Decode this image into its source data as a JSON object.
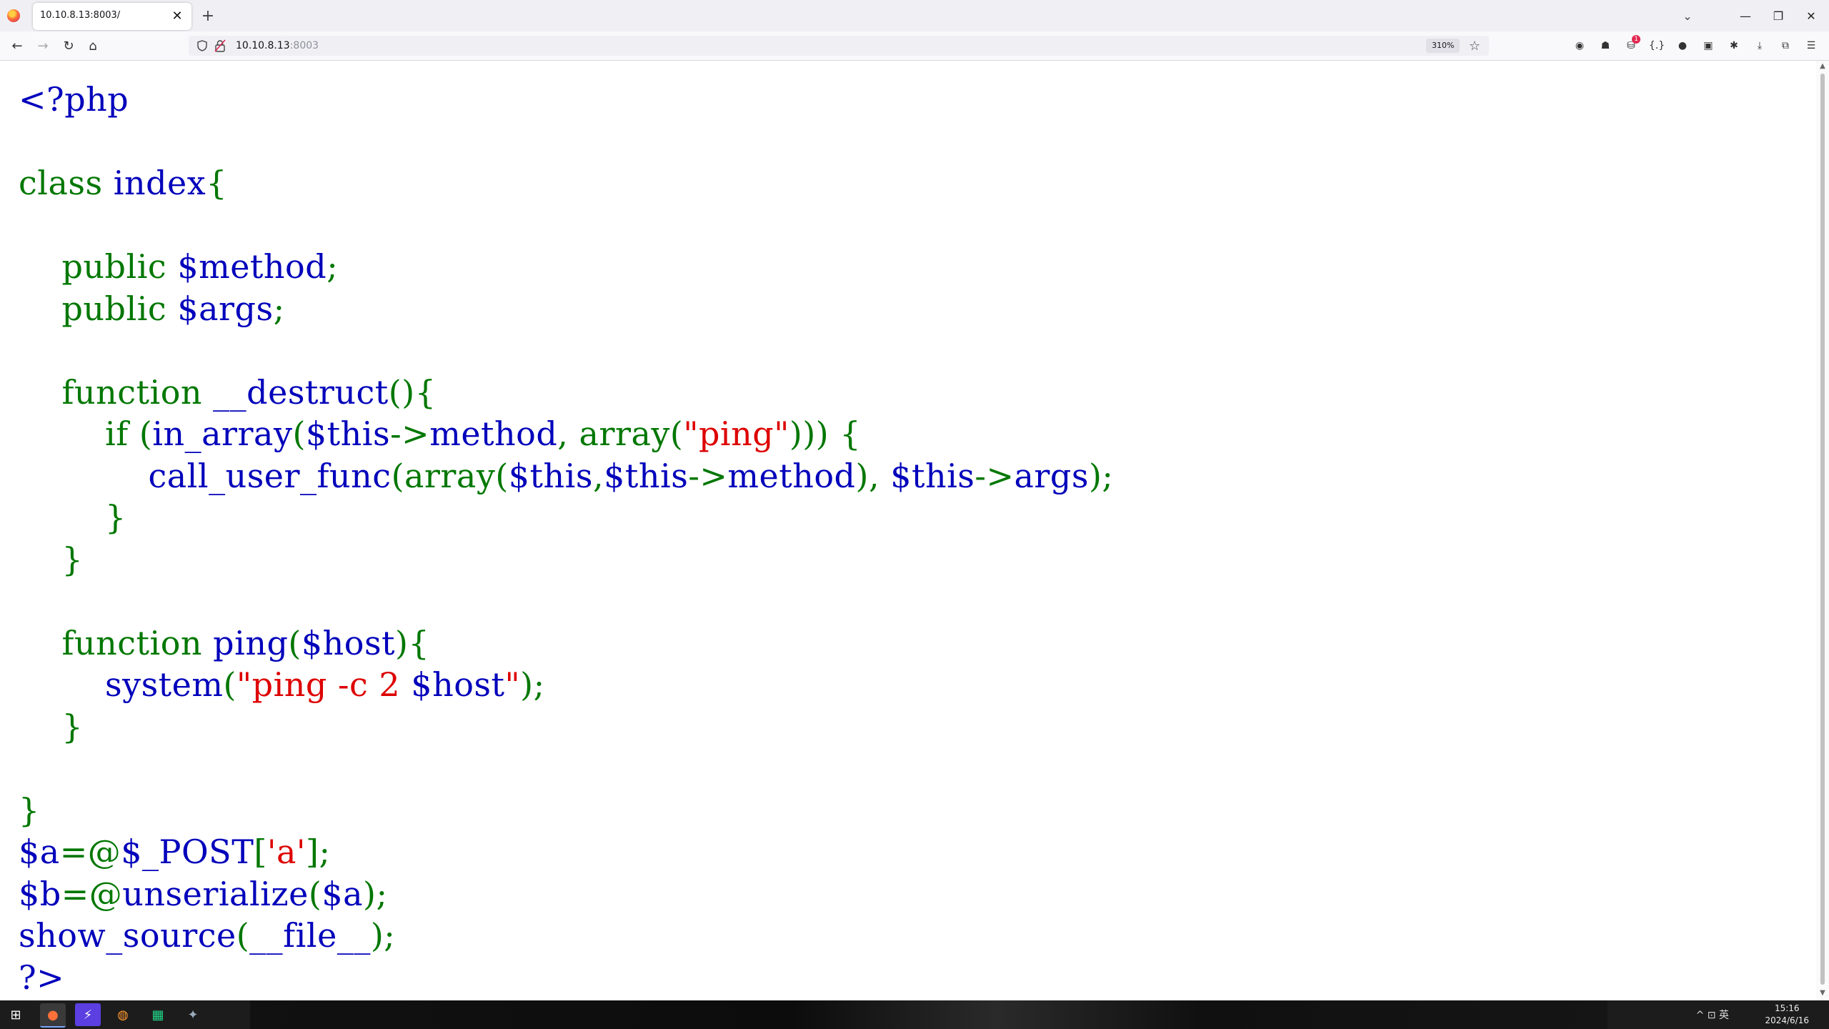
{
  "browser": {
    "tab_title": "10.10.8.13:8003/",
    "tab_close": "✕",
    "new_tab": "+",
    "tab_list": "⌄",
    "window_controls": {
      "minimize": "—",
      "restore": "❐",
      "close": "✕"
    },
    "nav": {
      "back": "←",
      "forward": "→",
      "reload": "↻",
      "home": "⌂"
    },
    "url_host": "10.10.8.13",
    "url_port": ":8003",
    "zoom_label": "310%",
    "bookmark_star": "☆",
    "extensions": [
      {
        "name": "circle-extension-icon",
        "glyph": "◉"
      },
      {
        "name": "hat-extension-icon",
        "glyph": "☗"
      },
      {
        "name": "badge-extension-icon",
        "glyph": "⛁",
        "badge": "1"
      },
      {
        "name": "braces-extension-icon",
        "glyph": "{.}"
      },
      {
        "name": "cookie-extension-icon",
        "glyph": "●"
      },
      {
        "name": "container-extension-icon",
        "glyph": "▣"
      },
      {
        "name": "gear-extension-icon",
        "glyph": "✱"
      },
      {
        "name": "downloads-icon",
        "glyph": "⤓"
      },
      {
        "name": "extensions-puzzle-icon",
        "glyph": "⧉"
      },
      {
        "name": "menu-icon",
        "glyph": "☰"
      }
    ]
  },
  "page": {
    "code_lines": [
      [
        {
          "t": "<?php",
          "c": "def"
        }
      ],
      [],
      [
        {
          "t": "class ",
          "c": "kw"
        },
        {
          "t": "index",
          "c": "def"
        },
        {
          "t": "{",
          "c": "kw"
        }
      ],
      [],
      [
        {
          "t": "    public ",
          "c": "kw"
        },
        {
          "t": "$method",
          "c": "def"
        },
        {
          "t": ";",
          "c": "kw"
        }
      ],
      [
        {
          "t": "    public ",
          "c": "kw"
        },
        {
          "t": "$args",
          "c": "def"
        },
        {
          "t": ";",
          "c": "kw"
        }
      ],
      [],
      [
        {
          "t": "    function ",
          "c": "kw"
        },
        {
          "t": "__destruct",
          "c": "def"
        },
        {
          "t": "(){",
          "c": "kw"
        }
      ],
      [
        {
          "t": "        if ",
          "c": "kw"
        },
        {
          "t": "(",
          "c": "kw"
        },
        {
          "t": "in_array",
          "c": "def"
        },
        {
          "t": "(",
          "c": "kw"
        },
        {
          "t": "$this",
          "c": "def"
        },
        {
          "t": "->",
          "c": "kw"
        },
        {
          "t": "method",
          "c": "def"
        },
        {
          "t": ", ",
          "c": "kw"
        },
        {
          "t": "array",
          "c": "kw"
        },
        {
          "t": "(",
          "c": "kw"
        },
        {
          "t": "\"ping\"",
          "c": "str"
        },
        {
          "t": "))) {",
          "c": "kw"
        }
      ],
      [
        {
          "t": "            call_user_func",
          "c": "def"
        },
        {
          "t": "(array(",
          "c": "kw"
        },
        {
          "t": "$this",
          "c": "def"
        },
        {
          "t": ",",
          "c": "kw"
        },
        {
          "t": "$this",
          "c": "def"
        },
        {
          "t": "->",
          "c": "kw"
        },
        {
          "t": "method",
          "c": "def"
        },
        {
          "t": "), ",
          "c": "kw"
        },
        {
          "t": "$this",
          "c": "def"
        },
        {
          "t": "->",
          "c": "kw"
        },
        {
          "t": "args",
          "c": "def"
        },
        {
          "t": ");",
          "c": "kw"
        }
      ],
      [
        {
          "t": "        }",
          "c": "kw"
        }
      ],
      [
        {
          "t": "    }",
          "c": "kw"
        }
      ],
      [],
      [
        {
          "t": "    function ",
          "c": "kw"
        },
        {
          "t": "ping",
          "c": "def"
        },
        {
          "t": "(",
          "c": "kw"
        },
        {
          "t": "$host",
          "c": "def"
        },
        {
          "t": "){",
          "c": "kw"
        }
      ],
      [
        {
          "t": "        system",
          "c": "def"
        },
        {
          "t": "(",
          "c": "kw"
        },
        {
          "t": "\"ping -c 2 ",
          "c": "str"
        },
        {
          "t": "$host",
          "c": "def"
        },
        {
          "t": "\"",
          "c": "str"
        },
        {
          "t": ");",
          "c": "kw"
        }
      ],
      [
        {
          "t": "    }",
          "c": "kw"
        }
      ],
      [],
      [
        {
          "t": "}",
          "c": "kw"
        }
      ],
      [
        {
          "t": "$a",
          "c": "def"
        },
        {
          "t": "=@",
          "c": "kw"
        },
        {
          "t": "$_POST",
          "c": "def"
        },
        {
          "t": "[",
          "c": "kw"
        },
        {
          "t": "'a'",
          "c": "str"
        },
        {
          "t": "];",
          "c": "kw"
        }
      ],
      [
        {
          "t": "$b",
          "c": "def"
        },
        {
          "t": "=@",
          "c": "kw"
        },
        {
          "t": "unserialize",
          "c": "def"
        },
        {
          "t": "(",
          "c": "kw"
        },
        {
          "t": "$a",
          "c": "def"
        },
        {
          "t": ");",
          "c": "kw"
        }
      ],
      [
        {
          "t": "show_source",
          "c": "def"
        },
        {
          "t": "(",
          "c": "kw"
        },
        {
          "t": "__file__",
          "c": "def"
        },
        {
          "t": ");",
          "c": "kw"
        }
      ],
      [
        {
          "t": "?>",
          "c": "def"
        }
      ]
    ]
  },
  "colors": {
    "default": "#0000bb",
    "keyword": "#007700",
    "string": "#dd0000"
  },
  "taskbar": {
    "start_glyph": "⊞",
    "apps": [
      {
        "name": "firefox-taskbar-icon",
        "glyph": "●",
        "active": true
      },
      {
        "name": "lightning-app-taskbar-icon",
        "glyph": "⚡",
        "active": false
      },
      {
        "name": "chrome-taskbar-icon",
        "glyph": "◍",
        "active": false
      },
      {
        "name": "pycharm-taskbar-icon",
        "glyph": "▦",
        "active": false
      },
      {
        "name": "app-taskbar-icon",
        "glyph": "✦",
        "active": false
      }
    ],
    "tray_text": "^  ⊡  英",
    "time": "15:16",
    "date": "2024/6/16"
  }
}
